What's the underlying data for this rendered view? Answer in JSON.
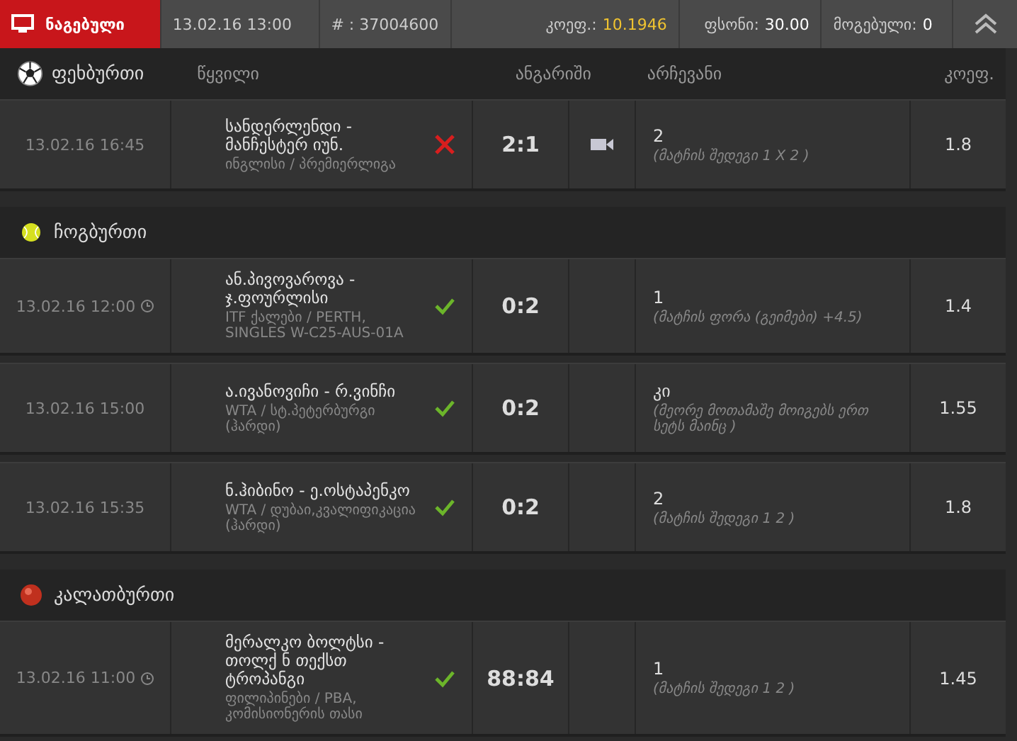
{
  "summary": {
    "status": "ნაგებული",
    "datetime": "13.02.16 13:00",
    "ticket": "# : 37004600",
    "odds_label": "კოეფ.:",
    "odds": "10.1946",
    "stake_label": "ფსონი:",
    "stake": "30.00",
    "win_label": "მოგებული:",
    "win": "0"
  },
  "columns": [
    "წყვილი",
    "ანგარიში",
    "არჩევანი",
    "კოეფ."
  ],
  "sports": [
    {
      "name": "ფეხბურთი",
      "kind": "football",
      "bets": [
        {
          "time": "13.02.16 16:45",
          "clock": false,
          "teams": "სანდერლენდი - მანჩესტერ იუნ.",
          "league": "ინგლისი / პრემიერლიგა",
          "won": false,
          "score": "2:1",
          "video": true,
          "pick": "2",
          "market": "(მატჩის შედეგი 1 X 2 )",
          "odds": "1.8"
        }
      ]
    },
    {
      "name": "ჩოგბურთი",
      "kind": "tennis",
      "bets": [
        {
          "time": "13.02.16 12:00",
          "clock": true,
          "teams": "ან.პივოვაროვა - ჯ.ფოურლისი",
          "league": "ITF ქალები / PERTH, SINGLES W-C25-AUS-01A",
          "won": true,
          "score": "0:2",
          "video": false,
          "pick": "1",
          "market": "(მატჩის ფორა (გეიმები) +4.5)",
          "odds": "1.4"
        },
        {
          "time": "13.02.16 15:00",
          "clock": false,
          "teams": "ა.ივანოვიჩი - რ.ვინჩი",
          "league": "WTA / სტ.პეტერბურგი (ჰარდი)",
          "won": true,
          "score": "0:2",
          "video": false,
          "pick": "კი",
          "market": "(მეორე მოთამაშე მოიგებს ერთ სეტს მაინც )",
          "odds": "1.55"
        },
        {
          "time": "13.02.16 15:35",
          "clock": false,
          "teams": "ნ.ჰიბინო - ე.ოსტაპენკო",
          "league": "WTA / დუბაი,კვალიფიკაცია (ჰარდი)",
          "won": true,
          "score": "0:2",
          "video": false,
          "pick": "2",
          "market": "(მატჩის შედეგი 1 2 )",
          "odds": "1.8"
        }
      ]
    },
    {
      "name": "კალათბურთი",
      "kind": "basketball",
      "bets": [
        {
          "time": "13.02.16 11:00",
          "clock": true,
          "teams": "მერალკო ბოლტსი - თოლქ ნ თექსთ ტროპანგი",
          "league": "ფილიპინები / PBA, კომისიონერის თასი",
          "won": true,
          "score": "88:84",
          "video": false,
          "pick": "1",
          "market": "(მატჩის შედეგი 1 2 )",
          "odds": "1.45"
        }
      ]
    }
  ]
}
